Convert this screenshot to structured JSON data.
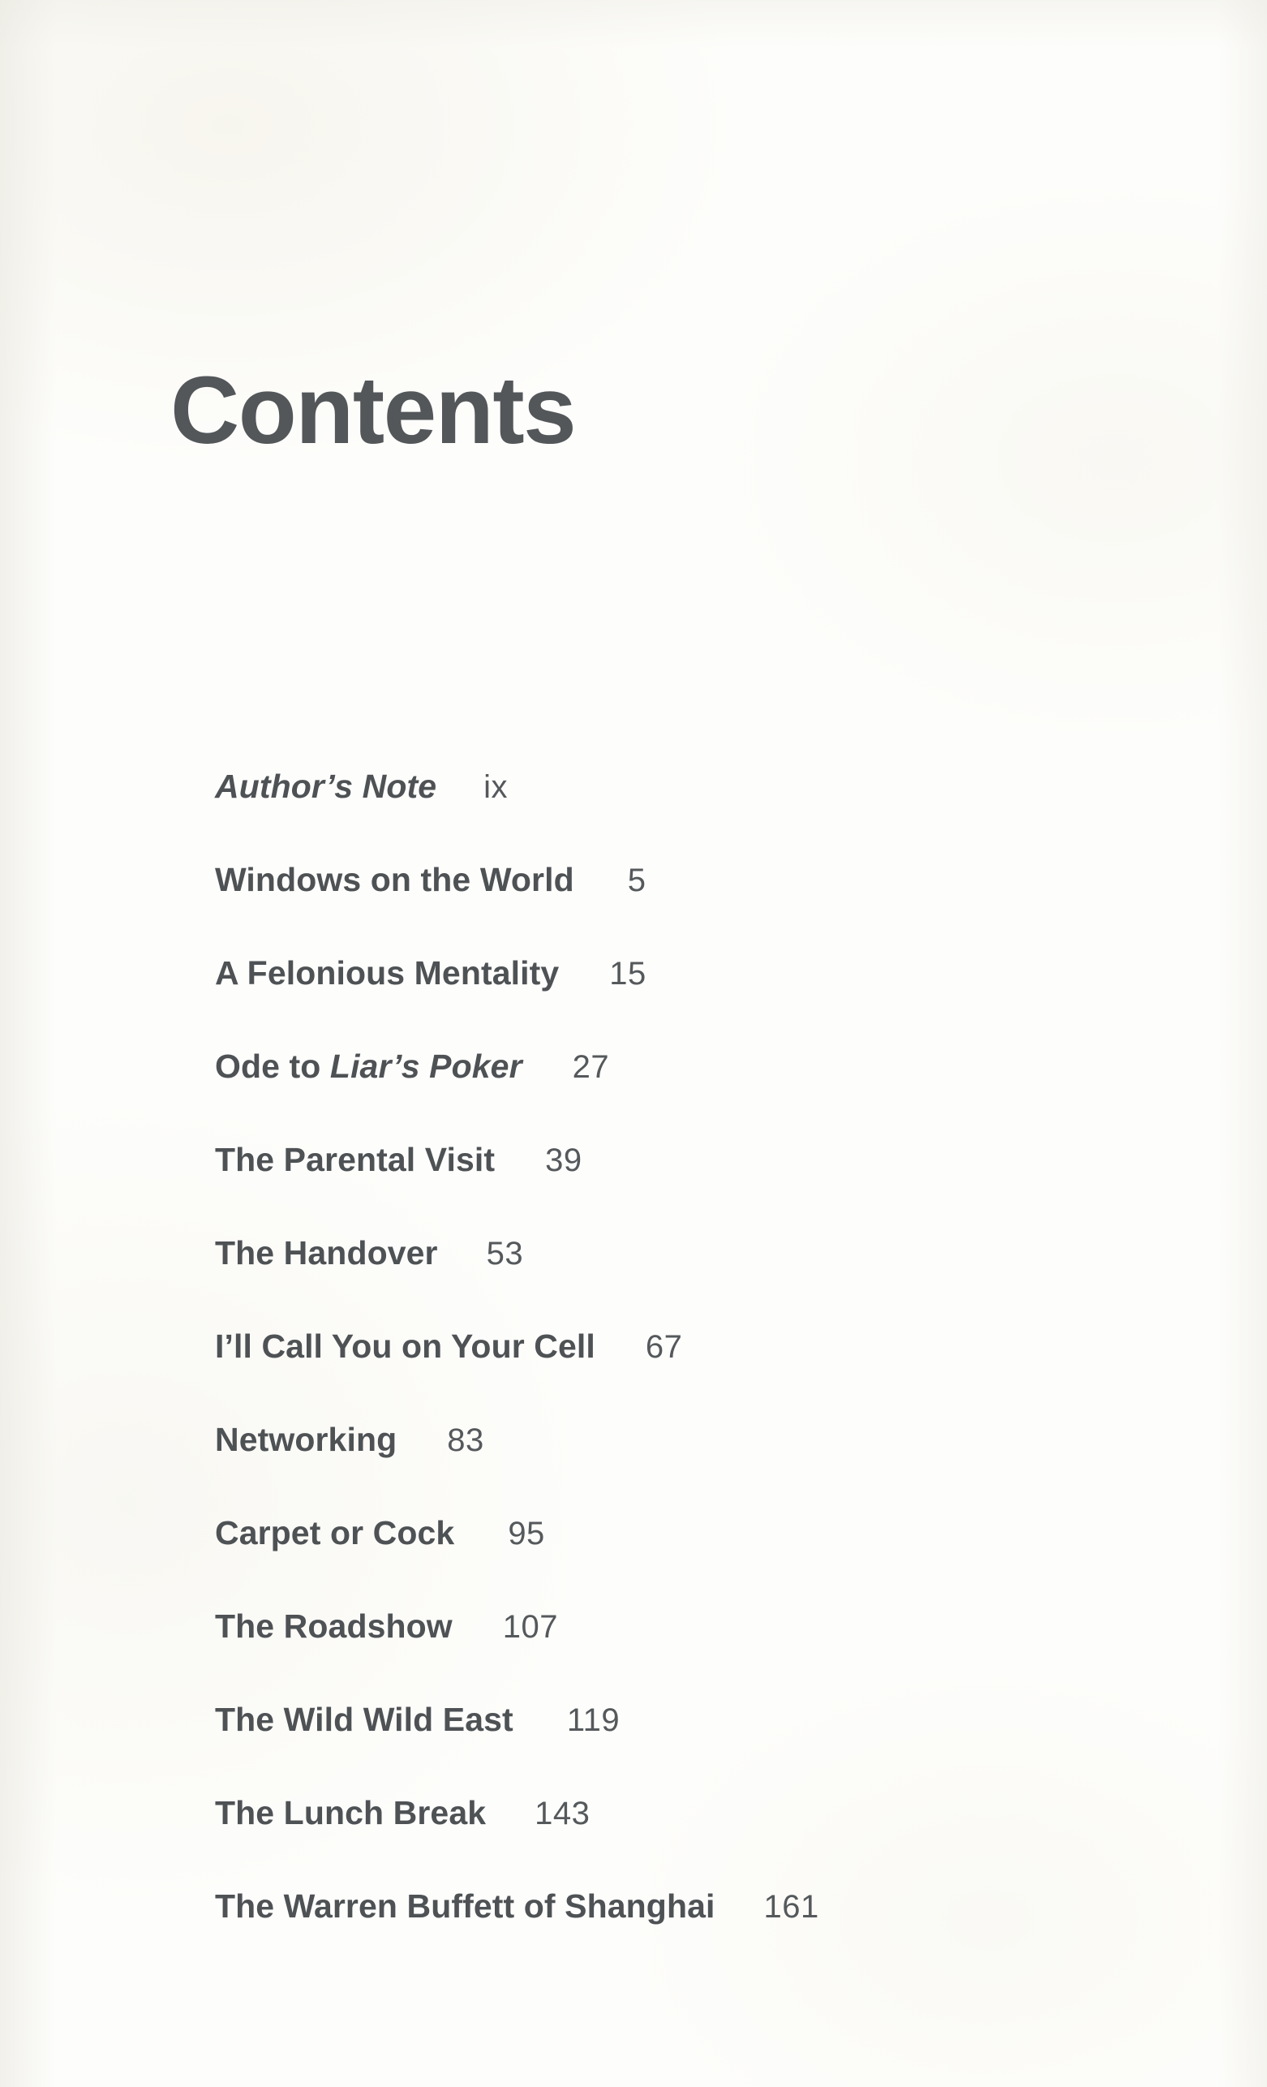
{
  "page": {
    "title": "Contents",
    "text_color": "#4e5255",
    "title_color": "#53575a",
    "background_color": "#fdfdfb"
  },
  "toc": {
    "entries": [
      {
        "title": "Author’s Note",
        "title_plain": "Author’s Note",
        "title_pre": "",
        "title_italic": "Author’s Note",
        "style": "italic",
        "page": "ix",
        "gap": 58
      },
      {
        "title": "Windows on the World",
        "title_plain": "Windows on the World",
        "title_pre": "",
        "title_italic": "",
        "style": "roman",
        "page": "5",
        "gap": 66
      },
      {
        "title": "A Felonious Mentality",
        "title_plain": "A Felonious Mentality",
        "title_pre": "",
        "title_italic": "",
        "style": "roman",
        "page": "15",
        "gap": 62
      },
      {
        "title": "Ode to Liar’s Poker",
        "title_plain": "",
        "title_pre": "Ode to ",
        "title_italic": "Liar’s Poker",
        "style": "mixed",
        "page": "27",
        "gap": 62
      },
      {
        "title": "The Parental Visit",
        "title_plain": "The Parental Visit",
        "title_pre": "",
        "title_italic": "",
        "style": "roman",
        "page": "39",
        "gap": 62
      },
      {
        "title": "The Handover",
        "title_plain": "The Handover",
        "title_pre": "",
        "title_italic": "",
        "style": "roman",
        "page": "53",
        "gap": 60
      },
      {
        "title": "I’ll Call You on Your Cell",
        "title_plain": "I’ll Call You on Your Cell",
        "title_pre": "",
        "title_italic": "",
        "style": "roman",
        "page": "67",
        "gap": 62
      },
      {
        "title": "Networking",
        "title_plain": "Networking",
        "title_pre": "",
        "title_italic": "",
        "style": "roman",
        "page": "83",
        "gap": 62
      },
      {
        "title": "Carpet or Cock",
        "title_plain": "Carpet or Cock",
        "title_pre": "",
        "title_italic": "",
        "style": "roman",
        "page": "95",
        "gap": 66
      },
      {
        "title": "The Roadshow",
        "title_plain": "The Roadshow",
        "title_pre": "",
        "title_italic": "",
        "style": "roman",
        "page": "107",
        "gap": 62
      },
      {
        "title": "The Wild Wild East",
        "title_plain": "The Wild Wild East",
        "title_pre": "",
        "title_italic": "",
        "style": "roman",
        "page": "119",
        "gap": 66
      },
      {
        "title": "The Lunch Break",
        "title_plain": "The Lunch Break",
        "title_pre": "",
        "title_italic": "",
        "style": "roman",
        "page": "143",
        "gap": 60
      },
      {
        "title": "The Warren Buffett of Shanghai",
        "title_plain": "The Warren Buffett of Shanghai",
        "title_pre": "",
        "title_italic": "",
        "style": "roman",
        "page": "161",
        "gap": 60
      }
    ]
  }
}
